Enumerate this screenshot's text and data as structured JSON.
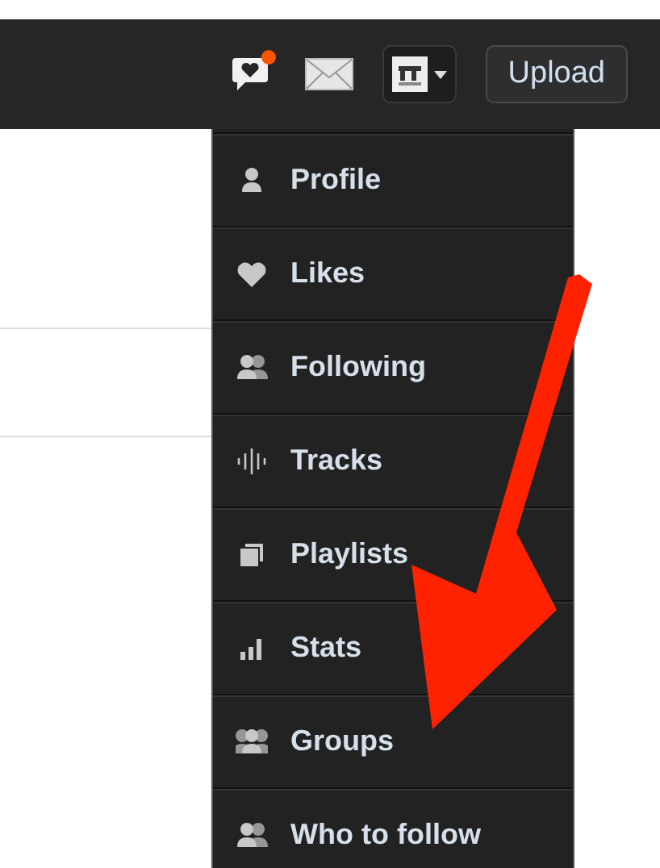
{
  "header": {
    "notifications": {
      "unread": true
    },
    "upload_button": "Upload"
  },
  "menu": {
    "items": [
      {
        "label": "Profile",
        "kind": "person"
      },
      {
        "label": "Likes",
        "kind": "heart"
      },
      {
        "label": "Following",
        "kind": "pair"
      },
      {
        "label": "Tracks",
        "kind": "wave"
      },
      {
        "label": "Playlists",
        "kind": "stack"
      },
      {
        "label": "Stats",
        "kind": "bars"
      },
      {
        "label": "Groups",
        "kind": "group"
      },
      {
        "label": "Who to follow",
        "kind": "pair"
      }
    ]
  }
}
